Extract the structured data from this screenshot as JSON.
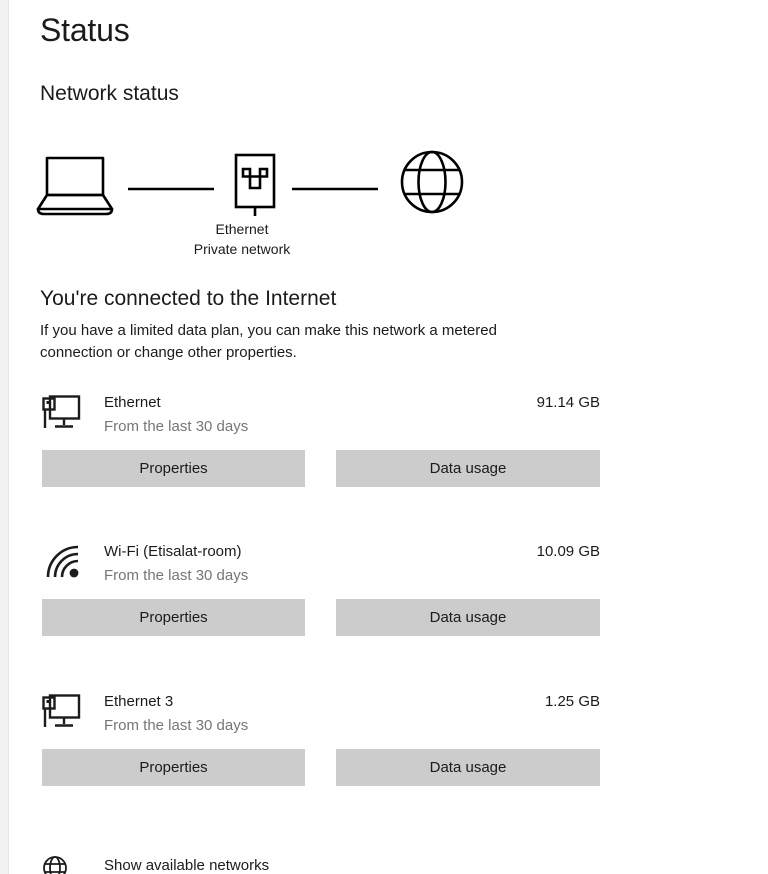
{
  "page": {
    "title": "Status",
    "section_subtitle": "Network status"
  },
  "topology": {
    "device_icon": "laptop-icon",
    "adapter_icon": "ethernet-port-icon",
    "internet_icon": "globe-icon",
    "adapter_name": "Ethernet",
    "network_type": "Private network"
  },
  "connection": {
    "heading": "You're connected to the Internet",
    "body": "If you have a limited data plan, you can make this network a metered connection or change other properties."
  },
  "buttons": {
    "properties_label": "Properties",
    "data_usage_label": "Data usage"
  },
  "adapters": [
    {
      "icon": "ethernet-monitor-icon",
      "name": "Ethernet",
      "subtitle": "From the last 30 days",
      "usage": "91.14 GB"
    },
    {
      "icon": "wifi-icon",
      "name": "Wi-Fi (Etisalat-room)",
      "subtitle": "From the last 30 days",
      "usage": "10.09 GB"
    },
    {
      "icon": "ethernet-monitor-icon",
      "name": "Ethernet 3",
      "subtitle": "From the last 30 days",
      "usage": "1.25 GB"
    }
  ],
  "bottom_item": {
    "icon": "globe-icon",
    "label": "Show available networks"
  },
  "colors": {
    "button_background": "#cccccc",
    "text_primary": "#1b1b1b",
    "text_secondary": "#767676",
    "sidebar_edge": "#f2f2f2",
    "page_background": "#ffffff"
  }
}
